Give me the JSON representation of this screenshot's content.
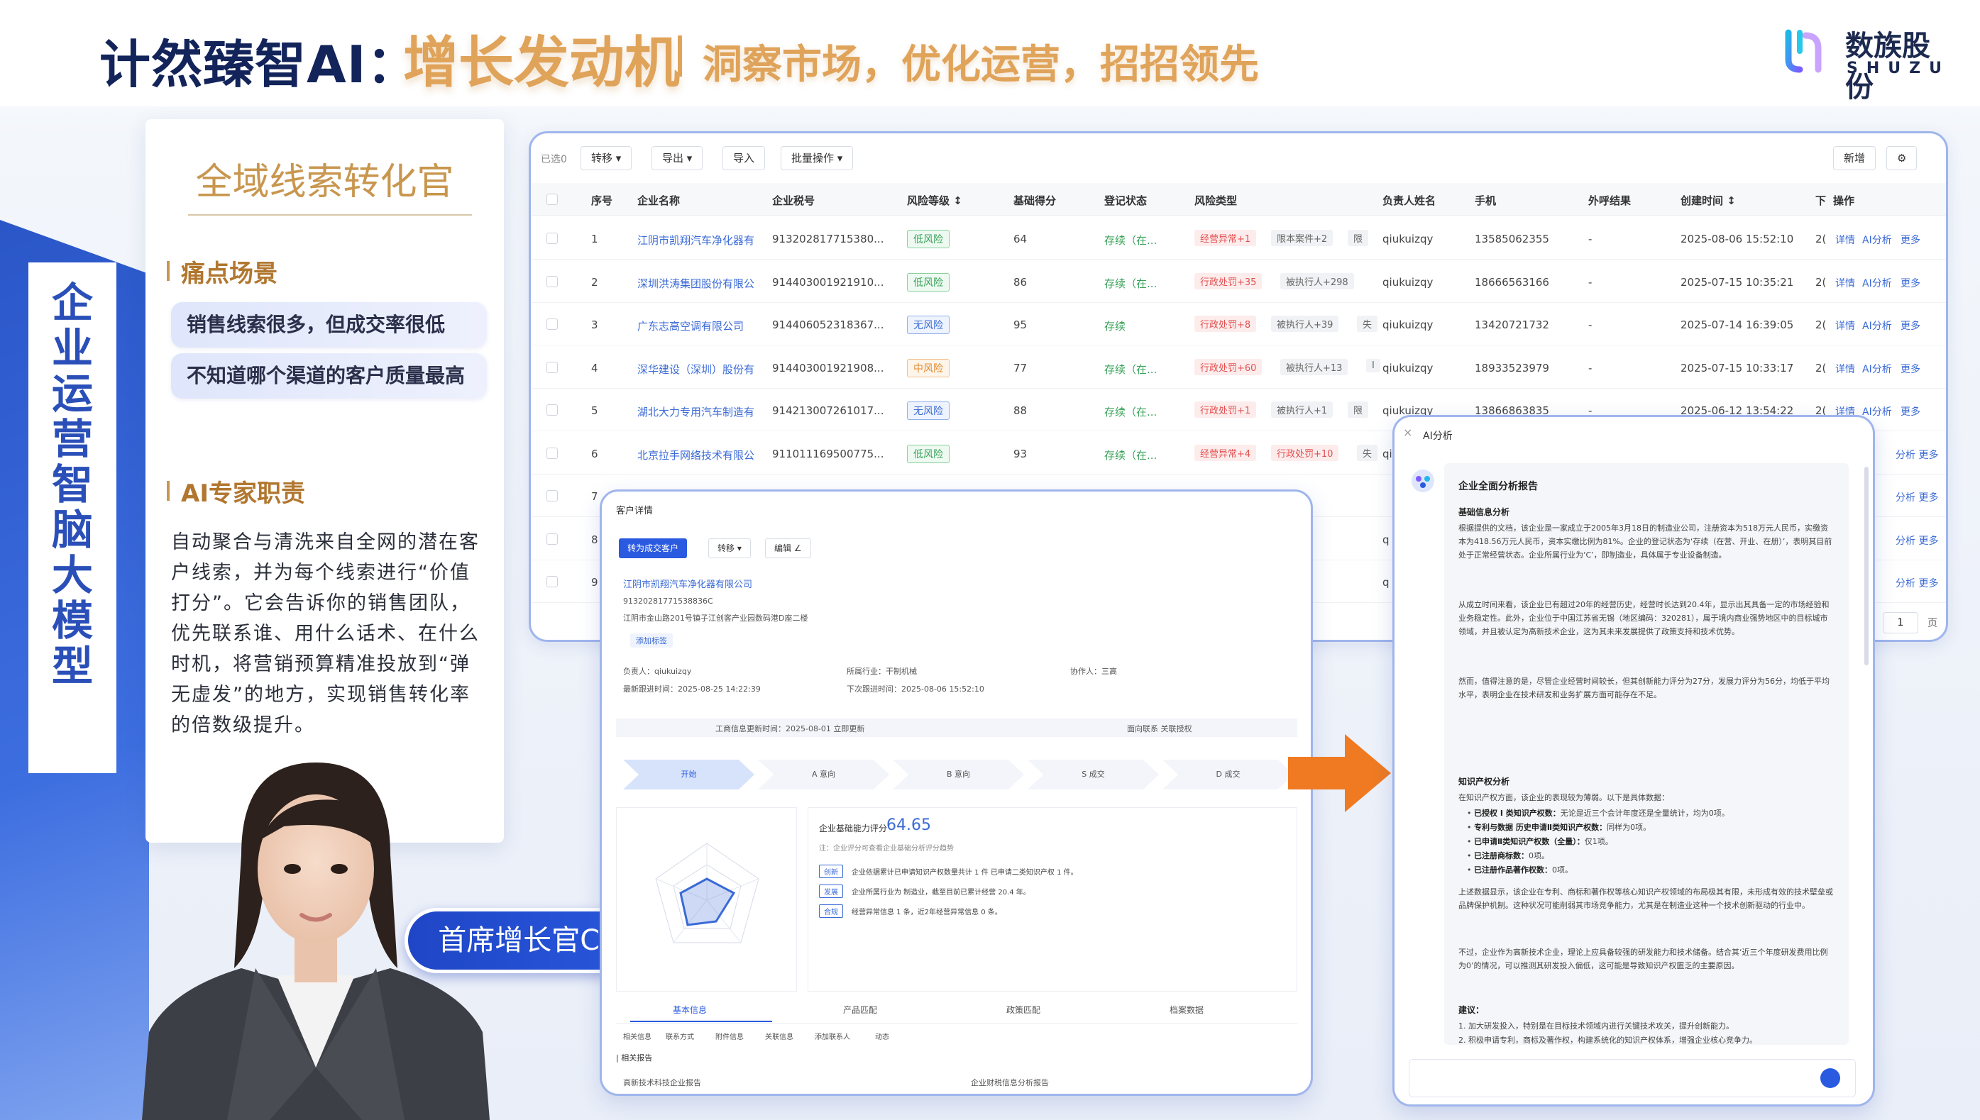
{
  "header": {
    "brand": "计然臻智AI：",
    "hero": "增长发动机",
    "sub": "洞察市场，优化运营，招招领先"
  },
  "logo": {
    "cn": "数族股份",
    "en": "SHUZU"
  },
  "vertical_label": "企业运营智脑大模型",
  "info_card": {
    "title": "全域线索转化官",
    "pain_head": "痛点场景",
    "pains": [
      "销售线索很多，但成交率很低",
      "不知道哪个渠道的客户质量最高"
    ],
    "duty_head": "AI专家职责",
    "duty_text": "自动聚合与清洗来自全网的潜在客户线索，并为每个线索进行“价值打分”。它会告诉你的销售团队，优先联系谁、用什么话术、在什么时机，将营销预算精准投放到“弹无虚发”的地方，实现销售转化率的倍数级提升。"
  },
  "cgo_badge": "首席增长官CGO",
  "colors": {
    "accent": "#2a5ae0",
    "gold": "#e0a35a",
    "navy": "#13245a",
    "arrow": "#ef7a22"
  },
  "table": {
    "selected": "已选0",
    "buttons": [
      "转移 ▾",
      "导出 ▾",
      "导入",
      "批量操作 ▾"
    ],
    "right_buttons": [
      "新增",
      "⚙"
    ],
    "headers": [
      "序号",
      "企业名称",
      "企业税号",
      "风险等级 ↕",
      "基础得分",
      "登记状态",
      "风险类型",
      "负责人姓名",
      "手机",
      "外呼结果",
      "创建时间 ↕",
      "下",
      "操作"
    ],
    "rows": [
      {
        "no": "1",
        "name": "江阴市凯翔汽车净化器有",
        "tax": "913202817715380...",
        "level": "低风险",
        "lt": "low",
        "score": "64",
        "status": "存续（在...",
        "tags": [
          "经营异常+1",
          "限本案件+2",
          "限"
        ],
        "owner": "qiukuizqy",
        "phone": "13585062355",
        "result": "-",
        "time": "2025-08-06 15:52:10",
        "next": "2("
      },
      {
        "no": "2",
        "name": "深圳洪涛集团股份有限公",
        "tax": "914403001921910...",
        "level": "低风险",
        "lt": "low",
        "score": "86",
        "status": "存续（在...",
        "tags": [
          "行政处罚+35",
          "被执行人+298"
        ],
        "owner": "qiukuizqy",
        "phone": "18666563166",
        "result": "-",
        "time": "2025-07-15 10:35:21",
        "next": "2("
      },
      {
        "no": "3",
        "name": "广东志高空调有限公司",
        "tax": "914406052318367...",
        "level": "无风险",
        "lt": "none",
        "score": "95",
        "status": "存续",
        "tags": [
          "行政处罚+8",
          "被执行人+39",
          "失"
        ],
        "owner": "qiukuizqy",
        "phone": "13420721732",
        "result": "-",
        "time": "2025-07-14 16:39:05",
        "next": "2("
      },
      {
        "no": "4",
        "name": "深华建设（深圳）股份有",
        "tax": "914403001921908...",
        "level": "中风险",
        "lt": "mid",
        "score": "77",
        "status": "存续（在...",
        "tags": [
          "行政处罚+60",
          "被执行人+13",
          "I"
        ],
        "owner": "qiukuizqy",
        "phone": "18933523979",
        "result": "-",
        "time": "2025-07-15 10:33:17",
        "next": "2("
      },
      {
        "no": "5",
        "name": "湖北大力专用汽车制造有",
        "tax": "914213007261017...",
        "level": "无风险",
        "lt": "none",
        "score": "88",
        "status": "存续（在...",
        "tags": [
          "行政处罚+1",
          "被执行人+1",
          "限"
        ],
        "owner": "qiukuizqy",
        "phone": "13866863835",
        "result": "-",
        "time": "2025-06-12 13:54:22",
        "next": "2("
      },
      {
        "no": "6",
        "name": "北京拉手网络技术有限公",
        "tax": "911011169500775...",
        "level": "低风险",
        "lt": "low",
        "score": "93",
        "status": "存续（在...",
        "tags": [
          "经营异常+4",
          "行政处罚+10",
          "失"
        ],
        "owner": "qiukuizqy",
        "phone": "",
        "result": "",
        "time": "",
        "next": ""
      },
      {
        "no": "7",
        "name": "",
        "tax": "",
        "level": "",
        "lt": "",
        "score": "",
        "status": "",
        "tags": [],
        "owner": "",
        "phone": "",
        "result": "",
        "time": "",
        "next": ""
      },
      {
        "no": "8",
        "name": "",
        "tax": "",
        "level": "",
        "lt": "",
        "score": "",
        "status": "",
        "tags": [],
        "owner": "q",
        "phone": "",
        "result": "",
        "time": "",
        "next": ""
      },
      {
        "no": "9",
        "name": "",
        "tax": "",
        "level": "",
        "lt": "",
        "score": "",
        "status": "",
        "tags": [],
        "owner": "q",
        "phone": "",
        "result": "",
        "time": "",
        "next": ""
      }
    ],
    "actions": [
      "详情",
      "AI分析",
      "更多"
    ],
    "partial_actions": "分析 更多",
    "pager": {
      "page": "1",
      "unit": "页"
    }
  },
  "detail": {
    "title": "客户详情",
    "btn_main": "转为成交客户",
    "btns": [
      "转移 ▾",
      "编辑 ∠"
    ],
    "company": "江阴市凯翔汽车净化器有限公司",
    "tax": "91320281771538836C",
    "addr": "江阴市金山路201号镇子江创客产业园数码港D座二楼",
    "tag": "添加标签",
    "meta": [
      {
        "k": "负责人：",
        "v": "qiukuizqy"
      },
      {
        "k": "所属行业：",
        "v": "干制机械"
      },
      {
        "k": "协作人：",
        "v": "三高"
      },
      {
        "k": "最新跟进时间：",
        "v": "2025-08-25 14:22:39"
      },
      {
        "k": "下次跟进时间：",
        "v": "2025-08-06 15:52:10"
      }
    ],
    "band_left": "工商信息更新时间：2025-08-01 立即更新",
    "band_right": "面向联系 关联授权",
    "steps": [
      "开始",
      "A 意向",
      "B 意向",
      "S 成交",
      "D 成交"
    ],
    "score_label": "企业基础能力评分",
    "score_value": "64.65",
    "score_note": "注：企业评分可查看企业基础分析评分趋势",
    "score_rows": [
      {
        "chip": "创新",
        "text": "企业依据累计已申请知识产权数量共计 1 件 已申请二类知识产权 1 件。"
      },
      {
        "chip": "发展",
        "text": "企业所属行业为 制造业，截至目前已累计经营 20.4 年。"
      },
      {
        "chip": "合规",
        "text": "经营异常信息 1 条，近2年经营异常信息 0 条。"
      }
    ],
    "tabs": [
      "基本信息",
      "产品匹配",
      "政策匹配",
      "档案数据"
    ],
    "sub_tabs": [
      "相关信息",
      "联系方式",
      "附件信息",
      "关联信息",
      "添加联系人",
      "动态"
    ],
    "section": "| 相关报告",
    "foot_left": "高新技术科技企业报告",
    "foot_right": "企业财税信息分析报告"
  },
  "ai": {
    "head": "AI分析",
    "report_title": "企业全面分析报告",
    "s1": "基础信息分析",
    "p1": "根据提供的文档，该企业是一家成立于2005年3月18日的制造业公司，注册资本为518万元人民币，实缴资本为418.56万元人民币，资本实缴比例为81%。企业的登记状态为‘存续（在营、开业、在册）’，表明其目前处于正常经营状态。企业所属行业为‘C’，即制造业，具体属于专业设备制造。",
    "p2": "从成立时间来看，该企业已有超过20年的经营历史，经营时长达到20.4年，显示出其具备一定的市场经验和业务稳定性。此外，企业位于中国江苏省无锡（地区编码：320281），属于境内商业强势地区中的目标城市领域，并且被认定为高新技术企业，这为其未来发展提供了政策支持和技术优势。",
    "p3": "然而，值得注意的是，尽管企业经营时间较长，但其创新能力评分为27分，发展力评分为56分，均低于平均水平，表明企业在技术研发和业务扩展方面可能存在不足。",
    "s2": "知识产权分析",
    "p4": "在知识产权方面，该企业的表现较为薄弱。以下是具体数据：",
    "list": [
      {
        "b": "已授权 I 类知识产权数：",
        "t": "无论是近三个会计年度还是全量统计，均为0项。"
      },
      {
        "b": "专利与数据 历史申请Ⅱ类知识产权数：",
        "t": "同样为0项。"
      },
      {
        "b": "已申请Ⅱ类知识产权数（全量）：",
        "t": "仅1项。"
      },
      {
        "b": "已注册商标数：",
        "t": "0项。"
      },
      {
        "b": "已注册作品著作权数：",
        "t": "0项。"
      }
    ],
    "p5": "上述数据显示，该企业在专利、商标和著作权等核心知识产权领域的布局极其有限，未形成有效的技术壁垒或品牌保护机制。这种状况可能削弱其市场竞争能力，尤其是在制造业这种一个技术创新驱动的行业中。",
    "p6": "不过，企业作为高新技术企业，理论上应具备较强的研发能力和技术储备。结合其‘近三个年度研发费用比例为0’的情况，可以推测其研发投入偏低，这可能是导致知识产权匮乏的主要原因。",
    "s3": "建议：",
    "suggest": [
      "1. 加大研发投入，特别是在目标技术领域内进行关键技术攻关，提升创新能力。",
      "2. 积极申请专利，商标及著作权，构建系统化的知识产权体系，增强企业核心竞争力。"
    ]
  }
}
